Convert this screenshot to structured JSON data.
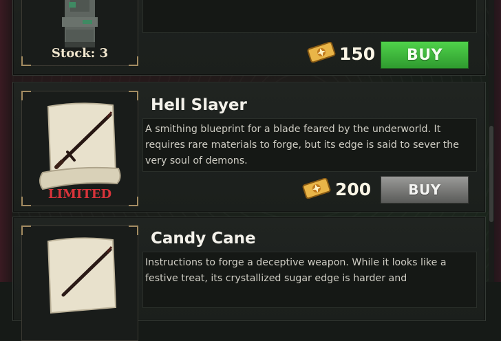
{
  "items": [
    {
      "name": "",
      "description": "",
      "badge": "Stock: 3",
      "badge_color": "#f2e7cf",
      "price": "150",
      "buy_label": "BUY",
      "buy_style": "green",
      "icon": "stone-statue-icon"
    },
    {
      "name": "Hell Slayer",
      "description": "A smithing blueprint for a blade feared by the underworld. It requires rare materials to forge, but its edge is said to sever the very soul of demons.",
      "badge": "LIMITED",
      "badge_color": "#d8333a",
      "price": "200",
      "buy_label": "BUY",
      "buy_style": "gray",
      "icon": "blueprint-scroll-icon"
    },
    {
      "name": "Candy Cane",
      "description": "Instructions to forge a deceptive weapon. While it looks like a festive treat, its crystallized sugar edge is harder and",
      "badge": "",
      "badge_color": "",
      "price": "",
      "buy_label": "",
      "buy_style": "",
      "icon": "blueprint-scroll-icon"
    }
  ],
  "currency_icon": "gold-ticket-icon",
  "colors": {
    "buy_green": "#3cb73a",
    "buy_gray": "#7a7b79",
    "limited_red": "#d8333a",
    "gold": "#e9b548"
  }
}
